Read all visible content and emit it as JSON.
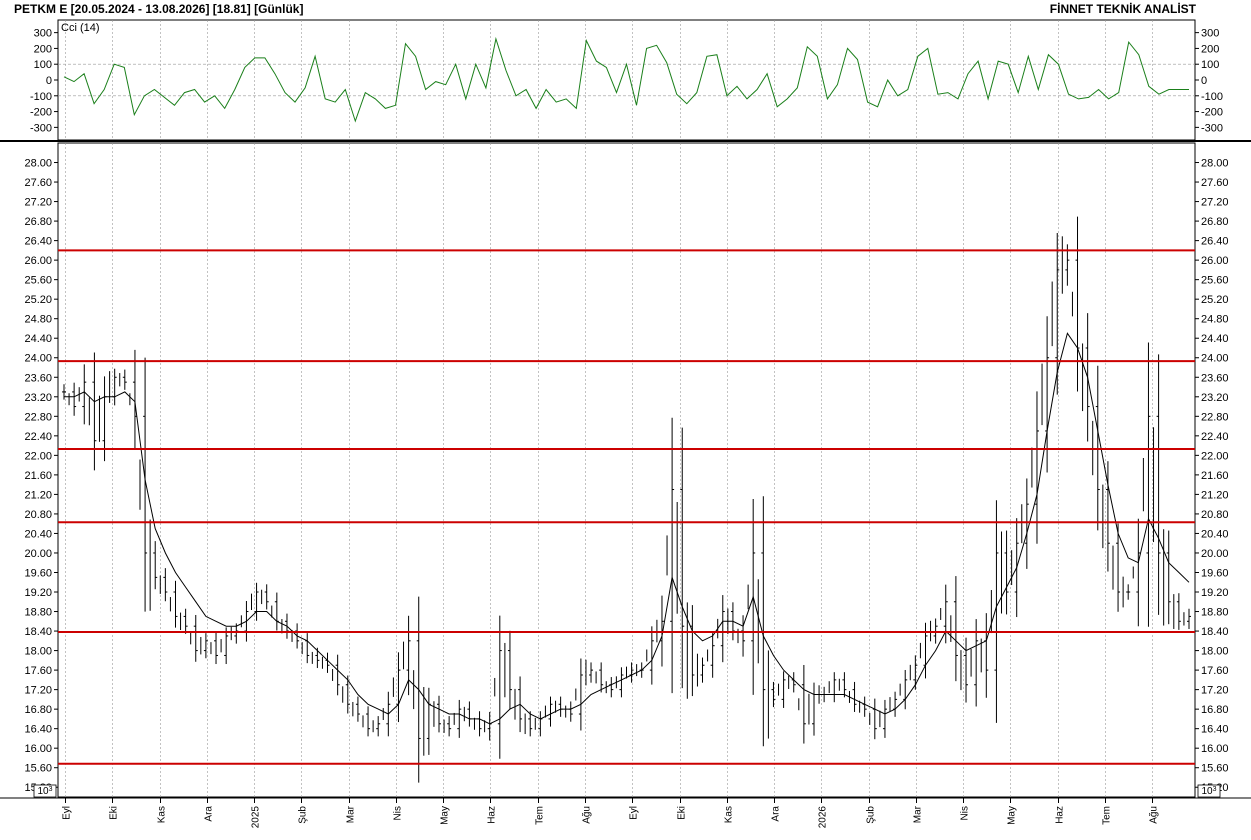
{
  "header": {
    "left": "PETKM E  [20.05.2024 - 13.08.2026]  [18.81]  [Günlük]",
    "right": "FİNNET TEKNİK ANALİST"
  },
  "colors": {
    "cci": "#1a7f1a",
    "resistance": "#cc0000",
    "bars": "#000000",
    "ma": "#000000",
    "grid": "#999999"
  },
  "chart_data": [
    {
      "type": "line",
      "title": "",
      "indicator_label": "Cci (14)",
      "ylim": [
        -380,
        380
      ],
      "yticks": [
        300,
        200,
        100,
        0,
        -100,
        -200,
        -300
      ],
      "ref_lines": [
        100,
        -100
      ],
      "x_range": [
        0,
        112
      ],
      "values": [
        20,
        -10,
        40,
        -150,
        -60,
        100,
        80,
        -220,
        -100,
        -60,
        -110,
        -160,
        -80,
        -60,
        -140,
        -100,
        -180,
        -60,
        80,
        140,
        140,
        40,
        -80,
        -140,
        -50,
        150,
        -120,
        -140,
        -60,
        -260,
        -80,
        -120,
        -180,
        -160,
        230,
        150,
        -60,
        -10,
        -30,
        100,
        -120,
        100,
        -50,
        260,
        60,
        -100,
        -60,
        -180,
        -60,
        -140,
        -120,
        -180,
        250,
        120,
        80,
        -80,
        100,
        -160,
        200,
        220,
        110,
        -90,
        -150,
        -80,
        150,
        160,
        -100,
        -40,
        -120,
        -60,
        40,
        -170,
        -120,
        -50,
        210,
        150,
        -120,
        -30,
        200,
        130,
        -140,
        -170,
        0,
        -100,
        -60,
        150,
        200,
        -90,
        -80,
        -120,
        40,
        120,
        -120,
        120,
        100,
        -80,
        150,
        -60,
        160,
        100,
        -90,
        -120,
        -110,
        -60,
        -120,
        -80,
        240,
        160,
        -40,
        -90,
        -60,
        -60,
        -60
      ]
    },
    {
      "type": "bar",
      "title": "",
      "ylim": [
        15.0,
        28.4
      ],
      "yticks": [
        "28.00",
        "27.60",
        "27.20",
        "26.80",
        "26.40",
        "26.00",
        "25.60",
        "25.20",
        "24.80",
        "24.40",
        "24.00",
        "23.60",
        "23.20",
        "22.80",
        "22.40",
        "22.00",
        "21.60",
        "21.20",
        "20.80",
        "20.40",
        "20.00",
        "19.60",
        "19.20",
        "18.80",
        "18.40",
        "18.00",
        "17.60",
        "17.20",
        "16.80",
        "16.40",
        "16.00",
        "15.60",
        "15.20"
      ],
      "scale_label": "10^3",
      "resistance_lines": [
        26.2,
        23.93,
        22.13,
        20.63,
        18.38,
        15.68
      ],
      "x_labels": [
        "Eyl",
        "Eki",
        "Kas",
        "Ara",
        "2025",
        "Şub",
        "Mar",
        "Nis",
        "May",
        "Haz",
        "Tem",
        "Ağu",
        "Eyl",
        "Eki",
        "Kas",
        "Ara",
        "2026",
        "Şub",
        "Mar",
        "Nis",
        "May",
        "Haz",
        "Tem",
        "Ağu"
      ],
      "x_range": [
        0,
        112
      ],
      "closes": [
        23.3,
        23.0,
        23.5,
        22.3,
        23.2,
        23.6,
        23.5,
        22.8,
        20.0,
        19.5,
        19.2,
        18.7,
        18.5,
        18.0,
        18.2,
        17.9,
        18.3,
        18.4,
        18.8,
        19.2,
        19.0,
        18.6,
        18.4,
        18.2,
        17.9,
        17.8,
        17.7,
        17.3,
        16.9,
        16.7,
        16.4,
        16.5,
        16.9,
        17.6,
        18.2,
        16.2,
        16.9,
        16.5,
        16.4,
        16.8,
        16.6,
        16.4,
        16.5,
        18.0,
        17.2,
        16.6,
        16.4,
        16.6,
        16.9,
        16.8,
        16.7,
        17.5,
        17.6,
        17.3,
        17.2,
        17.5,
        17.6,
        17.6,
        18.2,
        18.6,
        21.3,
        18.5,
        17.5,
        17.7,
        18.1,
        18.8,
        18.4,
        18.2,
        20.0,
        17.2,
        17.0,
        17.4,
        17.3,
        16.5,
        17.1,
        17.1,
        17.4,
        17.2,
        16.9,
        16.8,
        16.4,
        16.8,
        17.0,
        17.4,
        17.7,
        18.3,
        18.5,
        19.0,
        17.9,
        17.3,
        18.2,
        17.6,
        20.0,
        19.2,
        20.2,
        21.0,
        22.5,
        24.0,
        25.8,
        26.0,
        24.2,
        23.0,
        21.3,
        20.2,
        19.2,
        19.2,
        20.0,
        22.8,
        20.0,
        19.0,
        18.6,
        18.7
      ],
      "ma": [
        23.2,
        23.2,
        23.3,
        23.1,
        23.2,
        23.2,
        23.3,
        23.1,
        21.5,
        20.5,
        20.0,
        19.6,
        19.3,
        19.0,
        18.7,
        18.6,
        18.5,
        18.5,
        18.6,
        18.8,
        18.8,
        18.6,
        18.5,
        18.3,
        18.2,
        18.0,
        17.8,
        17.6,
        17.4,
        17.1,
        16.9,
        16.8,
        16.7,
        16.9,
        17.4,
        17.2,
        16.9,
        16.8,
        16.7,
        16.7,
        16.6,
        16.6,
        16.5,
        16.6,
        16.8,
        16.9,
        16.7,
        16.6,
        16.7,
        16.8,
        16.8,
        16.9,
        17.1,
        17.2,
        17.3,
        17.4,
        17.5,
        17.6,
        17.8,
        18.3,
        19.5,
        18.9,
        18.4,
        18.2,
        18.3,
        18.6,
        18.6,
        18.5,
        19.1,
        18.3,
        17.9,
        17.6,
        17.4,
        17.2,
        17.1,
        17.1,
        17.1,
        17.1,
        17.0,
        16.9,
        16.8,
        16.7,
        16.8,
        17.0,
        17.3,
        17.7,
        18.0,
        18.4,
        18.2,
        18.0,
        18.1,
        18.2,
        18.9,
        19.3,
        19.7,
        20.4,
        21.2,
        22.5,
        23.7,
        24.5,
        24.2,
        23.6,
        22.5,
        21.4,
        20.4,
        19.9,
        19.8,
        20.7,
        20.3,
        19.8,
        19.6,
        19.4
      ]
    }
  ]
}
